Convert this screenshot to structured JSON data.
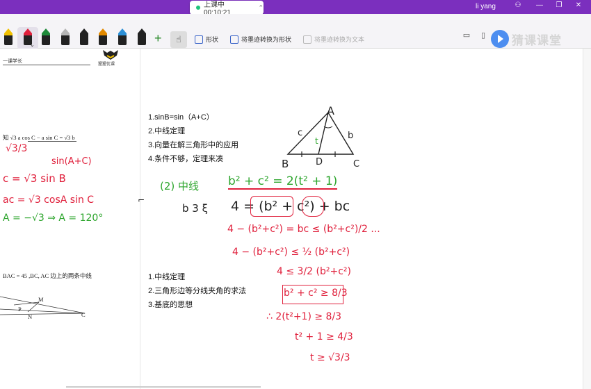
{
  "titlebar": {
    "live_status": "上课中 00:10:21",
    "user": "li yang"
  },
  "toolbar": {
    "shape_label": "形状",
    "convert_shape_label": "将墨迹转换为形状",
    "convert_text_label": "将墨迹转换为文本",
    "brand": "猜课课堂",
    "pen_colors": [
      "#f2c100",
      "#e0203c",
      "#1f8a3a",
      "#b5b5b5",
      "#222222",
      "#e38a00",
      "#2c8fd6",
      "#222222"
    ]
  },
  "document": {
    "header": "一课学长",
    "logo_caption": "猩猩优课",
    "question1": "知 √3 a cos C − a sin C = √3 b",
    "question2": "BAC = 45 ,BC, AC 边上的两条中线",
    "fig_labels": {
      "m": "M",
      "p": "P",
      "n": "N",
      "c": "C"
    }
  },
  "notes": {
    "list1": [
      "1.sinB=sin（A+C）",
      "2.中线定理",
      "3.向量在解三角形中的应用",
      "4.条件不够，定理来凑"
    ],
    "list2": [
      "1.中线定理",
      "2.三角形边等分线夹角的求法",
      "3.基底的思想"
    ]
  },
  "handwriting": {
    "left1": "√3/3",
    "left2": "sin(A+C)",
    "left3": "c = √3 sin B",
    "left4": "ac = √3 cosA sin C",
    "left5": "A = −√3 ⇒ A = 120°",
    "part2": "(2) 中线",
    "triangle_labels": {
      "top": "A",
      "left": "B",
      "bottom": "D",
      "right": "C",
      "side_c": "c",
      "side_b": "b",
      "median": "t"
    },
    "eq_green": "b² + c² = 2(t² + 1)",
    "step_word": "b 3 ξ",
    "eq_dark": "4 = (b² + c²) + bc",
    "lines": [
      "4 − (b²+c²) = bc ≤ (b²+c²)/2 ...",
      "4 − (b²+c²) ≤ ½ (b²+c²)",
      "4 ≤ 3/2 (b²+c²)",
      "b² + c² ≥ 8/3",
      "∴ 2(t²+1) ≥ 8/3",
      "t² + 1 ≥ 4/3",
      "t ≥ √3/3"
    ]
  }
}
